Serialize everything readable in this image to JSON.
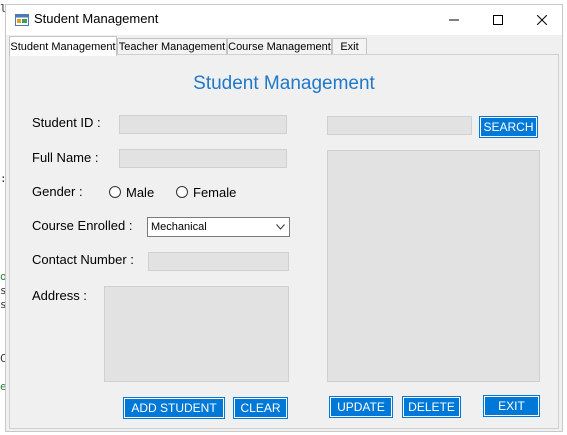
{
  "window": {
    "title": "Student Management"
  },
  "background_code": {
    "fragments": [
      "la",
      ":",
      "ox",
      "se",
      "se",
      "C",
      "ef"
    ]
  },
  "tabs": [
    {
      "label": "Student Management",
      "active": true
    },
    {
      "label": "Teacher Management",
      "active": false
    },
    {
      "label": "Course Management",
      "active": false
    },
    {
      "label": "Exit",
      "active": false
    }
  ],
  "form": {
    "heading": "Student Management",
    "student_id_label": "Student ID :",
    "student_id_value": "",
    "full_name_label": "Full Name :",
    "full_name_value": "",
    "gender_label": "Gender :",
    "gender_options": [
      "Male",
      "Female"
    ],
    "course_label": "Course Enrolled :",
    "course_value": "Mechanical",
    "contact_label": "Contact Number :",
    "contact_value": "",
    "address_label": "Address :",
    "address_value": ""
  },
  "search": {
    "value": "",
    "button_label": "SEARCH"
  },
  "buttons": {
    "add_student": "ADD STUDENT",
    "clear": "CLEAR",
    "update": "UPDATE",
    "delete": "DELETE",
    "exit": "EXIT"
  },
  "colors": {
    "accent": "#0078d7",
    "heading": "#1f78c9",
    "field_bg": "#e2e2e2",
    "window_bg": "#f0f0f0"
  },
  "icons": {
    "app": "app-form-icon",
    "minimize": "minimize-icon",
    "maximize": "maximize-icon",
    "close": "close-icon",
    "dropdown": "chevron-down-icon"
  }
}
